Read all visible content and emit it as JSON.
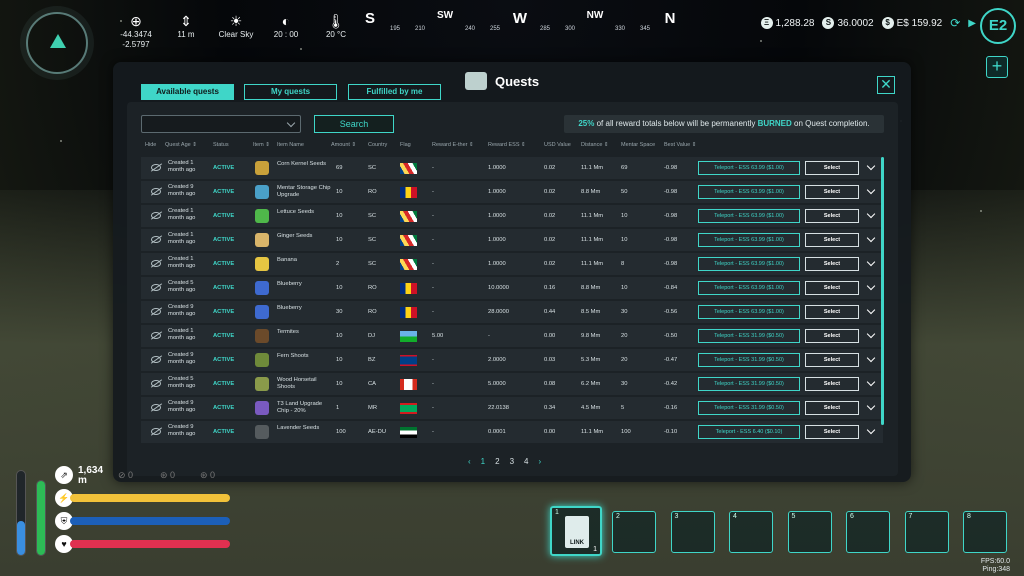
{
  "hud": {
    "coords": [
      "-44.3474",
      "-2.5797"
    ],
    "altitude": "11 m",
    "weather": "Clear Sky",
    "time": "20 : 00",
    "temperature": "20 °C",
    "heading_ticks": [
      {
        "label": "S",
        "type": "big"
      },
      {
        "label": "195",
        "type": "small"
      },
      {
        "label": "210",
        "type": "small"
      },
      {
        "label": "SW",
        "type": "mid"
      },
      {
        "label": "240",
        "type": "small"
      },
      {
        "label": "255",
        "type": "small"
      },
      {
        "label": "W",
        "type": "big"
      },
      {
        "label": "285",
        "type": "small"
      },
      {
        "label": "300",
        "type": "small"
      },
      {
        "label": "NW",
        "type": "mid"
      },
      {
        "label": "330",
        "type": "small"
      },
      {
        "label": "345",
        "type": "small"
      },
      {
        "label": "N",
        "type": "big"
      }
    ],
    "currency1": "1,288.28",
    "currency2": "36.0002",
    "currency3": "E$ 159.92",
    "altitude_readout": "1,634",
    "altitude_unit": "m",
    "small_counts": [
      "0",
      "0",
      "0"
    ],
    "fps": "FPS:60.0",
    "ping": "Ping:348",
    "bars": {
      "energy_pct": 0.92,
      "shield_pct": 0.43,
      "food_pct": 1.0,
      "water_pct": 1.0,
      "health_pct": 1.0
    }
  },
  "panel": {
    "title": "Quests",
    "tabs": [
      "Available quests",
      "My quests",
      "Fulfilled by me"
    ],
    "search_label": "Search",
    "notice_pct": "25%",
    "notice_mid": " of all reward totals below will be permanently ",
    "notice_burned": "BURNED",
    "notice_end": " on Quest completion.",
    "headers": [
      "Hide",
      "Quest Age ⇕",
      "Status",
      "Item ⇕",
      "Item Name",
      "Amount ⇕",
      "Country",
      "Flag",
      "Reward E-ther ⇕",
      "Reward ESS ⇕",
      "USD Value",
      "Distance ⇕",
      "Mentar Space",
      "Best Value ⇕"
    ],
    "select_label": "Select",
    "rows": [
      {
        "age": "Created 1 month ago",
        "status": "ACTIVE",
        "item": "Corn Kernel Seeds",
        "amount": "69",
        "country": "SC",
        "flag": "sc",
        "ether": "-",
        "ess": "1.0000",
        "usd": "0.02",
        "dist": "11.1 Mm",
        "ms": "69",
        "best": "-0.98",
        "teleport": "Teleport - ESS 63.99 ($1.00)",
        "icon": "#c9a13a"
      },
      {
        "age": "Created 9 month ago",
        "status": "ACTIVE",
        "item": "Mentar Storage Chip Upgrade",
        "amount": "10",
        "country": "RO",
        "flag": "ro",
        "ether": "-",
        "ess": "1.0000",
        "usd": "0.02",
        "dist": "8.8 Mm",
        "ms": "50",
        "best": "-0.98",
        "teleport": "Teleport - ESS 63.99 ($1.00)",
        "icon": "#4aa0c8"
      },
      {
        "age": "Created 1 month ago",
        "status": "ACTIVE",
        "item": "Lettuce Seeds",
        "amount": "10",
        "country": "SC",
        "flag": "sc",
        "ether": "-",
        "ess": "1.0000",
        "usd": "0.02",
        "dist": "11.1 Mm",
        "ms": "10",
        "best": "-0.98",
        "teleport": "Teleport - ESS 63.99 ($1.00)",
        "icon": "#4fb84a"
      },
      {
        "age": "Created 1 month ago",
        "status": "ACTIVE",
        "item": "Ginger Seeds",
        "amount": "10",
        "country": "SC",
        "flag": "sc",
        "ether": "-",
        "ess": "1.0000",
        "usd": "0.02",
        "dist": "11.1 Mm",
        "ms": "10",
        "best": "-0.98",
        "teleport": "Teleport - ESS 63.99 ($1.00)",
        "icon": "#d9b56a"
      },
      {
        "age": "Created 1 month ago",
        "status": "ACTIVE",
        "item": "Banana",
        "amount": "2",
        "country": "SC",
        "flag": "sc",
        "ether": "-",
        "ess": "1.0000",
        "usd": "0.02",
        "dist": "11.1 Mm",
        "ms": "8",
        "best": "-0.98",
        "teleport": "Teleport - ESS 63.99 ($1.00)",
        "icon": "#e5c542"
      },
      {
        "age": "Created 5 month ago",
        "status": "ACTIVE",
        "item": "Blueberry",
        "amount": "10",
        "country": "RO",
        "flag": "ro",
        "ether": "-",
        "ess": "10.0000",
        "usd": "0.16",
        "dist": "8.8 Mm",
        "ms": "10",
        "best": "-0.84",
        "teleport": "Teleport - ESS 63.99 ($1.00)",
        "icon": "#3e6ad0"
      },
      {
        "age": "Created 9 month ago",
        "status": "ACTIVE",
        "item": "Blueberry",
        "amount": "30",
        "country": "RO",
        "flag": "ro",
        "ether": "-",
        "ess": "28.0000",
        "usd": "0.44",
        "dist": "8.5 Mm",
        "ms": "30",
        "best": "-0.56",
        "teleport": "Teleport - ESS 63.99 ($1.00)",
        "icon": "#3e6ad0"
      },
      {
        "age": "Created 1 month ago",
        "status": "ACTIVE",
        "item": "Termites",
        "amount": "10",
        "country": "DJ",
        "flag": "dj",
        "ether": "5.00",
        "ess": "-",
        "usd": "0.00",
        "dist": "9.8 Mm",
        "ms": "20",
        "best": "-0.50",
        "teleport": "Teleport - ESS 31.99 ($0.50)",
        "icon": "#6b4a2a"
      },
      {
        "age": "Created 9 month ago",
        "status": "ACTIVE",
        "item": "Fern Shoots",
        "amount": "10",
        "country": "BZ",
        "flag": "bz",
        "ether": "-",
        "ess": "2.0000",
        "usd": "0.03",
        "dist": "5.3 Mm",
        "ms": "20",
        "best": "-0.47",
        "teleport": "Teleport - ESS 31.99 ($0.50)",
        "icon": "#6f8a3a"
      },
      {
        "age": "Created 5 month ago",
        "status": "ACTIVE",
        "item": "Wood Horsetail Shoots",
        "amount": "10",
        "country": "CA",
        "flag": "ca",
        "ether": "-",
        "ess": "5.0000",
        "usd": "0.08",
        "dist": "6.2 Mm",
        "ms": "30",
        "best": "-0.42",
        "teleport": "Teleport - ESS 31.99 ($0.50)",
        "icon": "#8a9a4a"
      },
      {
        "age": "Created 9 month ago",
        "status": "ACTIVE",
        "item": "T3 Land Upgrade Chip - 20%",
        "amount": "1",
        "country": "MR",
        "flag": "mr",
        "ether": "-",
        "ess": "22.0138",
        "usd": "0.34",
        "dist": "4.5 Mm",
        "ms": "5",
        "best": "-0.16",
        "teleport": "Teleport - ESS 31.99 ($0.50)",
        "icon": "#7a5ac0"
      },
      {
        "age": "Created 9 month ago",
        "status": "ACTIVE",
        "item": "Lavender Seeds",
        "amount": "100",
        "country": "AE-DU",
        "flag": "ae",
        "ether": "-",
        "ess": "0.0001",
        "usd": "0.00",
        "dist": "11.1 Mm",
        "ms": "100",
        "best": "-0.10",
        "teleport": "Teleport - ESS 6.40 ($0.10)",
        "icon": "#555b5e"
      }
    ],
    "pages": [
      "1",
      "2",
      "3",
      "4"
    ],
    "current_page": "1"
  },
  "hotbar": {
    "slots": [
      "1",
      "2",
      "3",
      "4",
      "5",
      "6",
      "7",
      "8"
    ],
    "first_item": "LINK",
    "first_count": "1"
  },
  "colors": {
    "accent": "#3fd6c8",
    "energy": "#f2c23a",
    "shield": "#1c5fb8",
    "health": "#e03050",
    "water": "#3a8fe0",
    "food": "#2dbb56"
  }
}
